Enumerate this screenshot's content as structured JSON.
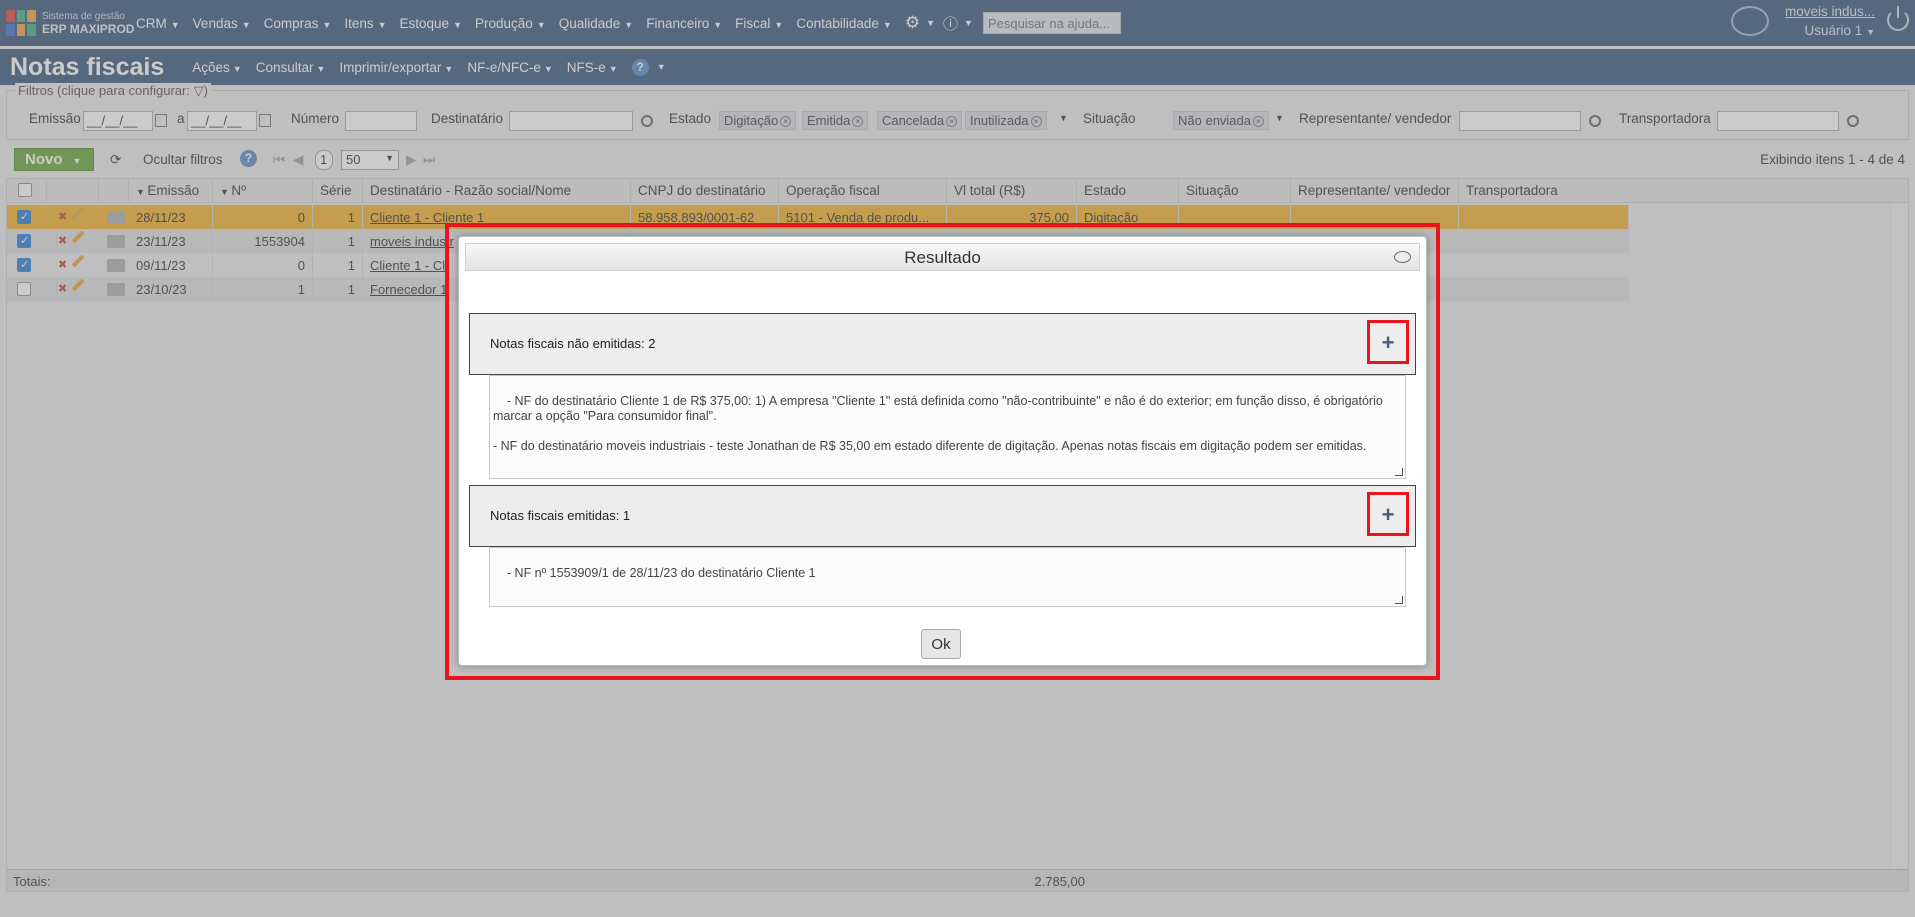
{
  "app": {
    "logo_line1": "Sistema de gestão",
    "logo_line2": "ERP MAXIPROD",
    "menu": [
      "CRM",
      "Vendas",
      "Compras",
      "Itens",
      "Estoque",
      "Produção",
      "Qualidade",
      "Financeiro",
      "Fiscal",
      "Contabilidade"
    ],
    "help_search_placeholder": "Pesquisar na ajuda...",
    "company_link": "moveis indus...",
    "user_label": "Usuário 1"
  },
  "page": {
    "title": "Notas fiscais",
    "menus": [
      "Ações",
      "Consultar",
      "Imprimir/exportar",
      "NF-e/NFC-e",
      "NFS-e"
    ]
  },
  "filters": {
    "legend": "Filtros (clique para configurar:",
    "emissao_label": "Emissão",
    "date_placeholder": "__/__/__",
    "a_label": "a",
    "numero_label": "Número",
    "destinatario_label": "Destinatário",
    "estado_label": "Estado",
    "estado_chips": [
      "Digitação",
      "Emitida",
      "Cancelada",
      "Inutilizada"
    ],
    "situacao_label": "Situação",
    "situacao_chips": [
      "Não enviada"
    ],
    "representante_label": "Representante/ vendedor",
    "transportadora_label": "Transportadora"
  },
  "toolbar": {
    "new_label": "Novo",
    "hide_filters_label": "Ocultar filtros",
    "page_number": "1",
    "page_size": "50",
    "items_info": "Exibindo itens 1 - 4 de 4"
  },
  "grid": {
    "headers": [
      "Emissão",
      "Nº",
      "Série",
      "Destinatário - Razão social/Nome",
      "CNPJ do destinatário",
      "Operação fiscal",
      "Vl total (R$)",
      "Estado",
      "Situação",
      "Representante/ vendedor",
      "Transportadora"
    ],
    "rows": [
      {
        "checked": true,
        "date": "28/11/23",
        "num": "0",
        "serie": "1",
        "dest": "Cliente 1 - Cliente 1",
        "cnpj": "58.958.893/0001-62",
        "op": "5101 - Venda de produ...",
        "total": "375,00",
        "estado": "Digitação"
      },
      {
        "checked": true,
        "date": "23/11/23",
        "num": "1553904",
        "serie": "1",
        "dest": "moveis industr",
        "cnpj": "",
        "op": "",
        "total": "",
        "estado": ""
      },
      {
        "checked": true,
        "date": "09/11/23",
        "num": "0",
        "serie": "1",
        "dest": "Cliente 1 - Cli",
        "cnpj": "",
        "op": "",
        "total": "",
        "estado": ""
      },
      {
        "checked": false,
        "date": "23/10/23",
        "num": "1",
        "serie": "1",
        "dest": "Fornecedor 1",
        "cnpj": "",
        "op": "",
        "total": "",
        "estado": ""
      }
    ],
    "totals_label": "Totais:",
    "totals_value": "2.785,00"
  },
  "dialog": {
    "title": "Resultado",
    "section1_label": "Notas fiscais não emitidas: 2",
    "section1_text": "- NF do destinatário Cliente 1 de R$ 375,00: 1) A empresa \"Cliente 1\" está definida como \"não-contribuinte\" e não é do exterior; em função disso, é obrigatório marcar a opção \"Para consumidor final\".\n\n- NF do destinatário moveis industriais - teste Jonathan de R$ 35,00 em estado diferente de digitação. Apenas notas fiscais em digitação podem ser emitidas.",
    "section2_label": "Notas fiscais emitidas: 1",
    "section2_text": "- NF nº 1553909/1 de 28/11/23 do destinatário Cliente 1",
    "plus_glyph": "+",
    "ok_label": "Ok"
  },
  "colors": {
    "nav_bg": "#2a4c72",
    "selected_row": "#f2ab1e",
    "new_button": "#5e9e2b",
    "highlight_frame": "#e8141e"
  }
}
